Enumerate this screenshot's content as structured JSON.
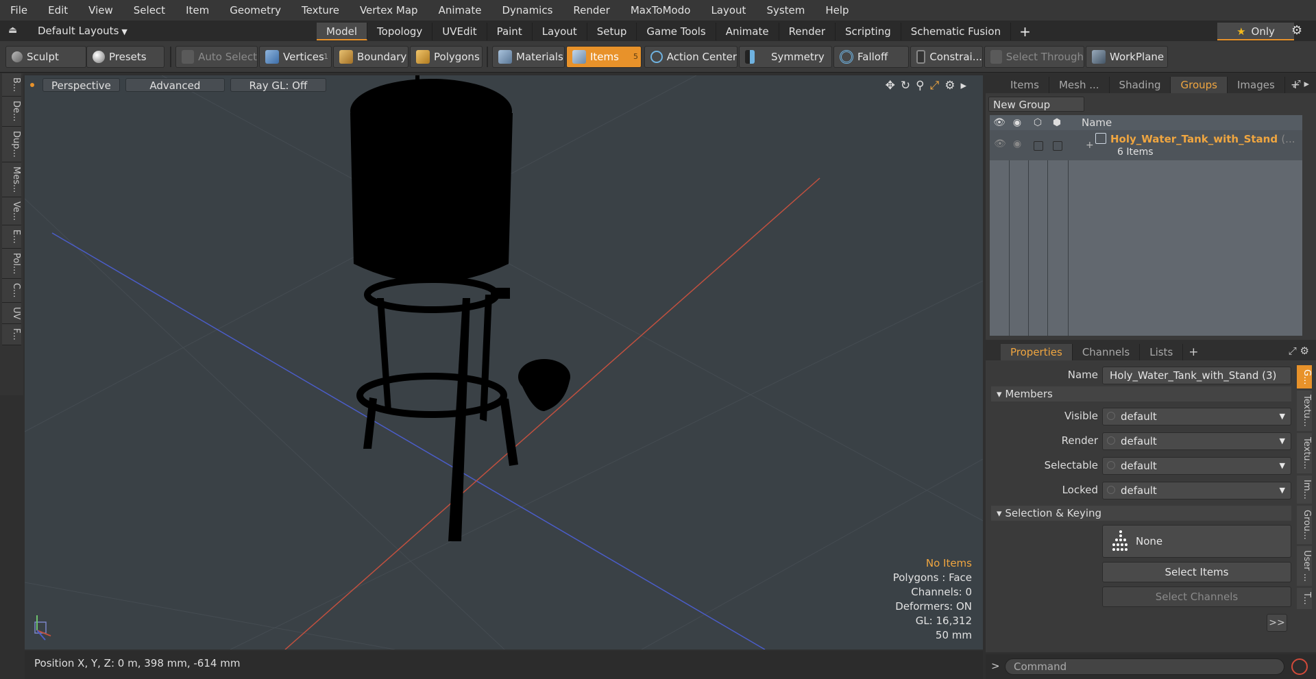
{
  "menu": [
    "File",
    "Edit",
    "View",
    "Select",
    "Item",
    "Geometry",
    "Texture",
    "Vertex Map",
    "Animate",
    "Dynamics",
    "Render",
    "MaxToModo",
    "Layout",
    "System",
    "Help"
  ],
  "layout_selector": "Default Layouts",
  "tabs": [
    "Model",
    "Topology",
    "UVEdit",
    "Paint",
    "Layout",
    "Setup",
    "Game Tools",
    "Animate",
    "Render",
    "Scripting",
    "Schematic Fusion"
  ],
  "active_tab": "Model",
  "only_label": "Only",
  "toolbar": {
    "sculpt": "Sculpt",
    "presets": "Presets",
    "auto_select": "Auto Select",
    "vertices": "Vertices",
    "vertices_count": "1",
    "boundary": "Boundary",
    "polygons": "Polygons",
    "materials": "Materials",
    "items": "Items",
    "items_count": "5",
    "action_center": "Action Center",
    "symmetry": "Symmetry",
    "falloff": "Falloff",
    "constrain": "Constrai...",
    "select_through": "Select Through",
    "workplane": "WorkPlane"
  },
  "left_tabs": [
    "B...",
    "De...",
    "Dup...",
    "Mes...",
    "Ve...",
    "E...",
    "Pol...",
    "C...",
    "UV",
    "F..."
  ],
  "viewport": {
    "view_mode": "Perspective",
    "shading": "Advanced",
    "raygl": "Ray GL: Off",
    "info": {
      "no_items": "No Items",
      "polygons": "Polygons : Face",
      "channels": "Channels: 0",
      "deformers": "Deformers: ON",
      "gl": "GL: 16,312",
      "scale": "50 mm"
    },
    "colors": {
      "background": "#3a4146",
      "x_axis": "#c2503f",
      "z_axis": "#4b5dc9",
      "silhouette": "#000000"
    }
  },
  "status": {
    "position": "Position X, Y, Z:   0 m, 398 mm, -614 mm"
  },
  "top_panel": {
    "tabs": [
      "Items",
      "Mesh ...",
      "Shading",
      "Groups",
      "Images"
    ],
    "active_tab": "Groups",
    "new_group": "New Group",
    "column_name": "Name",
    "group": {
      "name": "Holy_Water_Tank_with_Stand",
      "suffix": "(...",
      "count": "6 Items"
    }
  },
  "properties_panel": {
    "tabs": [
      "Properties",
      "Channels",
      "Lists"
    ],
    "active_tab": "Properties",
    "name_label": "Name",
    "name_value": "Holy_Water_Tank_with_Stand (3)",
    "members_section": "Members",
    "fields": [
      {
        "label": "Visible",
        "value": "default"
      },
      {
        "label": "Render",
        "value": "default"
      },
      {
        "label": "Selectable",
        "value": "default"
      },
      {
        "label": "Locked",
        "value": "default"
      }
    ],
    "keying_section": "Selection & Keying",
    "none_label": "None",
    "select_items": "Select Items",
    "select_channels": "Select Channels",
    "more": ">>",
    "side_tabs": [
      "G...",
      "Textu...",
      "Textu...",
      "Im...",
      "Grou...",
      "User ...",
      "T..."
    ]
  },
  "command": {
    "placeholder": "Command"
  },
  "accent_color": "#e8922a"
}
